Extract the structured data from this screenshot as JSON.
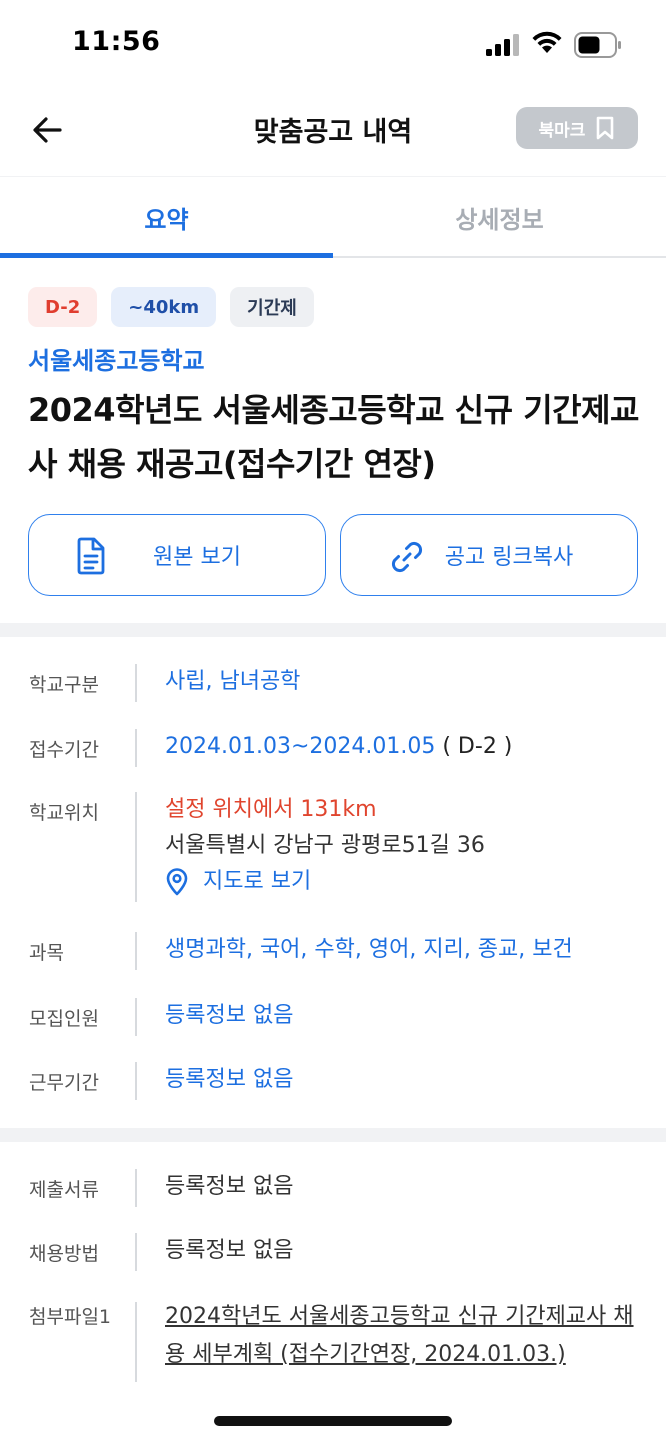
{
  "status_bar": {
    "time": "11:56"
  },
  "header": {
    "title": "맞춤공고 내역",
    "bookmark_label": "북마크"
  },
  "tabs": [
    {
      "label": "요약",
      "active": true
    },
    {
      "label": "상세정보",
      "active": false
    }
  ],
  "chips": {
    "dday": "D-2",
    "distance": "~40km",
    "type": "기간제"
  },
  "school_name": "서울세종고등학교",
  "post_title": "2024학년도 서울세종고등학교 신규 기간제교사 채용 재공고(접수기간 연장)",
  "actions": {
    "view_original": "원본 보기",
    "copy_link": "공고 링크복사"
  },
  "info": {
    "school_type": {
      "label": "학교구분",
      "value": "사립, 남녀공학"
    },
    "period": {
      "label": "접수기간",
      "value": "2024.01.03~2024.01.05",
      "dday": "( D-2 )"
    },
    "location": {
      "label": "학교위치",
      "distance": "설정 위치에서 131km",
      "address": "서울특별시 강남구 광평로51길 36",
      "map_link": "지도로 보기"
    },
    "subjects": {
      "label": "과목",
      "value": "생명과학, 국어, 수학, 영어, 지리, 종교, 보건"
    },
    "recruit_count": {
      "label": "모집인원",
      "value": "등록정보 없음"
    },
    "work_period": {
      "label": "근무기간",
      "value": "등록정보 없음"
    }
  },
  "extra": {
    "documents": {
      "label": "제출서류",
      "value": "등록정보 없음"
    },
    "method": {
      "label": "채용방법",
      "value": "등록정보 없음"
    },
    "attachment": {
      "label": "첨부파일1",
      "value": "2024학년도 서울세종고등학교 신규 기간제교사 채용 세부계획 (접수기간연장, 2024.01.03.)"
    }
  },
  "colors": {
    "accent": "#1d6fe0",
    "danger": "#e0452e",
    "muted": "#a8adb4"
  }
}
